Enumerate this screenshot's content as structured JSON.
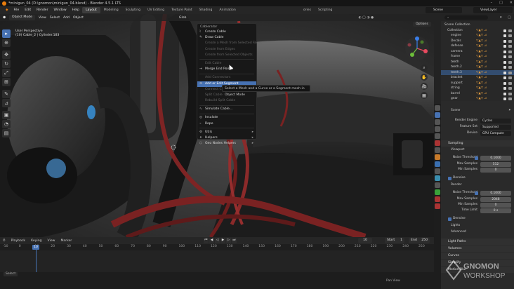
{
  "window": {
    "title": "*minigun_04 (D:\\gnomon\\minigun_04.blend) - Blender 4.5.1 LTS",
    "controls": [
      "–",
      "□",
      "✕"
    ]
  },
  "menubar": {
    "menus": [
      "File",
      "Edit",
      "Render",
      "Window",
      "Help"
    ],
    "workspaces": [
      "Layout",
      "Modeling",
      "Sculpting",
      "UV Editing",
      "Texture Paint",
      "Shading",
      "Animation"
    ],
    "workspaces_right": [
      "ories",
      "Scripting"
    ],
    "active_workspace": "Layout",
    "scene": "Scene",
    "view_layer": "ViewLayer"
  },
  "viewport": {
    "mode": "Object Mode",
    "menus": [
      "View",
      "Select",
      "Add",
      "Object"
    ],
    "global": "Glob",
    "info_line1": "User Perspective",
    "info_line2": "(10) Cable_2 | Cylinder.183",
    "options": "Options"
  },
  "menu": {
    "title": "Cablerator",
    "items": [
      {
        "label": "Create Cable",
        "state": "normal"
      },
      {
        "label": "Draw Cable",
        "state": "normal"
      },
      {
        "label": "Create a Mesh from Selected Faces",
        "state": "disabled"
      },
      {
        "label": "Create from Edges",
        "state": "disabled"
      },
      {
        "label": "Create from Selected Objects",
        "state": "disabled"
      },
      {
        "sep": true
      },
      {
        "label": "Edit Cable",
        "state": "disabled"
      },
      {
        "label": "Merge End Points",
        "state": "normal"
      },
      {
        "sep": true
      },
      {
        "label": "Add Connectors",
        "state": "disabled"
      },
      {
        "label": "Add or Edit Segment",
        "state": "highlight"
      },
      {
        "label": "Connect Cu",
        "state": "disabled"
      },
      {
        "label": "Split Cable",
        "state": "disabled"
      },
      {
        "label": "Rebuild Split Cable",
        "state": "disabled"
      },
      {
        "sep": true
      },
      {
        "label": "Simulate Cable...",
        "state": "normal"
      },
      {
        "sep": true
      },
      {
        "label": "Insulate",
        "state": "normal"
      },
      {
        "label": "Rope",
        "state": "normal"
      },
      {
        "sep": true
      },
      {
        "label": "Utils",
        "state": "normal",
        "submenu": true
      },
      {
        "label": "Helpers",
        "state": "normal",
        "submenu": true
      },
      {
        "label": "Geo Nodes Helpers",
        "state": "normal",
        "submenu": true
      }
    ]
  },
  "tooltip": "Select a Mesh and a Curve or a Segment mesh in Object Mode",
  "timeline": {
    "menus": [
      "Playback",
      "Keying",
      "View",
      "Marker"
    ],
    "current_frame": "10",
    "frame_display": "10",
    "start_label": "Start",
    "start": "1",
    "end_label": "End",
    "end": "250",
    "ticks": [
      "-10",
      "0",
      "10",
      "20",
      "30",
      "40",
      "50",
      "60",
      "70",
      "80",
      "90",
      "100",
      "110",
      "120",
      "130",
      "140",
      "150",
      "160",
      "170",
      "180",
      "190",
      "200",
      "210",
      "220",
      "230",
      "240",
      "250"
    ]
  },
  "statusbar": {
    "left": "Select",
    "right": "Pan View",
    "version": "4.5.1"
  },
  "outliner": {
    "search_placeholder": "",
    "rows": [
      "Scene Collection",
      "Collection",
      "engine",
      "Decals",
      "defense",
      "camera",
      "frame",
      "teeth",
      "teeth.2",
      "teeth.3",
      "bracket",
      "support",
      "string",
      "barrel",
      "gear"
    ]
  },
  "properties": {
    "scene": "Scene",
    "render_engine_label": "Render Engine",
    "render_engine": "Cycles",
    "feature_set_label": "Feature Set",
    "feature_set": "Supported",
    "device_label": "Device",
    "device": "GPU Compute",
    "sampling": "Sampling",
    "viewport": "Viewport",
    "noise_threshold_label": "Noise Threshold",
    "vp_noise_threshold": "0.1000",
    "max_samples_label": "Max Samples",
    "vp_max_samples": "512",
    "min_samples_label": "Min Samples",
    "vp_min_samples": "0",
    "denoise": "Denoise",
    "render": "Render",
    "r_noise_threshold": "0.1000",
    "r_max_samples": "2048",
    "r_min_samples": "0",
    "time_limit_label": "Time Limit",
    "time_limit": "0 s",
    "r_denoise": "Denoise",
    "lights": "Lights",
    "advanced": "Advanced",
    "light_paths": "Light Paths",
    "volumes": "Volumes",
    "curves": "Curves",
    "simplify": "Simplify",
    "motion_blur": "Motion Blur"
  },
  "watermark": {
    "line1": "GNOMON",
    "line2": "WORKSHOP"
  },
  "colors": {
    "accent": "#4772b3",
    "cable_red": "#8b2a2a",
    "orange": "#e87d0d"
  }
}
